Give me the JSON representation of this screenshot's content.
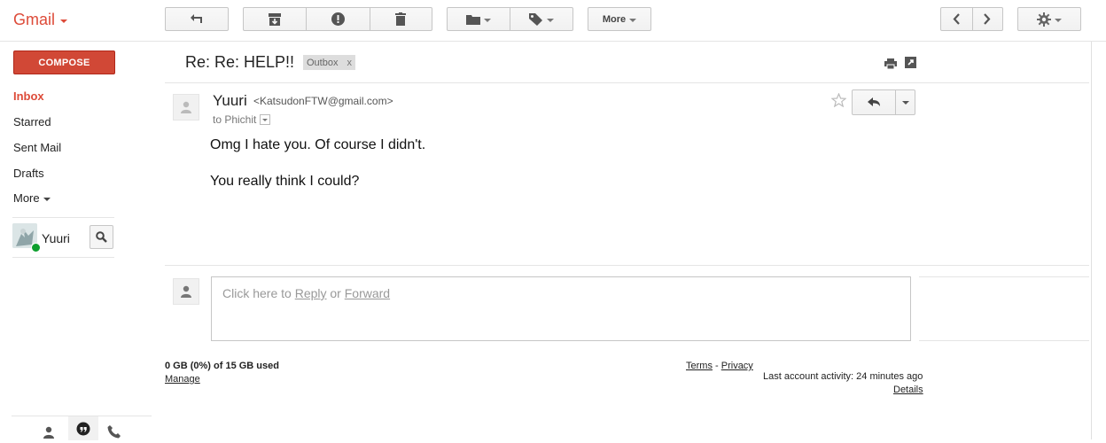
{
  "app": {
    "brand": "Gmail"
  },
  "toolbar": {
    "more_label": "More"
  },
  "sidebar": {
    "compose_label": "COMPOSE",
    "items": [
      {
        "label": "Inbox",
        "active": true
      },
      {
        "label": "Starred",
        "active": false
      },
      {
        "label": "Sent Mail",
        "active": false
      },
      {
        "label": "Drafts",
        "active": false
      },
      {
        "label": "More",
        "active": false
      }
    ],
    "chat_user": "Yuuri"
  },
  "thread": {
    "subject": "Re: Re: HELP!!",
    "label": "Outbox",
    "label_remove": "x"
  },
  "message": {
    "sender_name": "Yuuri",
    "sender_email": "<KatsudonFTW@gmail.com>",
    "to_line": "to Phichit",
    "body": [
      "Omg I hate you. Of course I didn't.",
      "You really think I could?"
    ]
  },
  "reply": {
    "prompt": "Click here to",
    "reply_link": "Reply",
    "or": "or",
    "forward_link": "Forward"
  },
  "footer": {
    "storage": "0 GB (0%) of 15 GB used",
    "manage": "Manage",
    "terms": "Terms",
    "dash": "-",
    "privacy": "Privacy",
    "activity": "Last account activity: 24 minutes ago",
    "details": "Details"
  },
  "colors": {
    "brand_red": "#dd4b39",
    "compose_red": "#d14836",
    "online_green": "#0d9f2e"
  }
}
